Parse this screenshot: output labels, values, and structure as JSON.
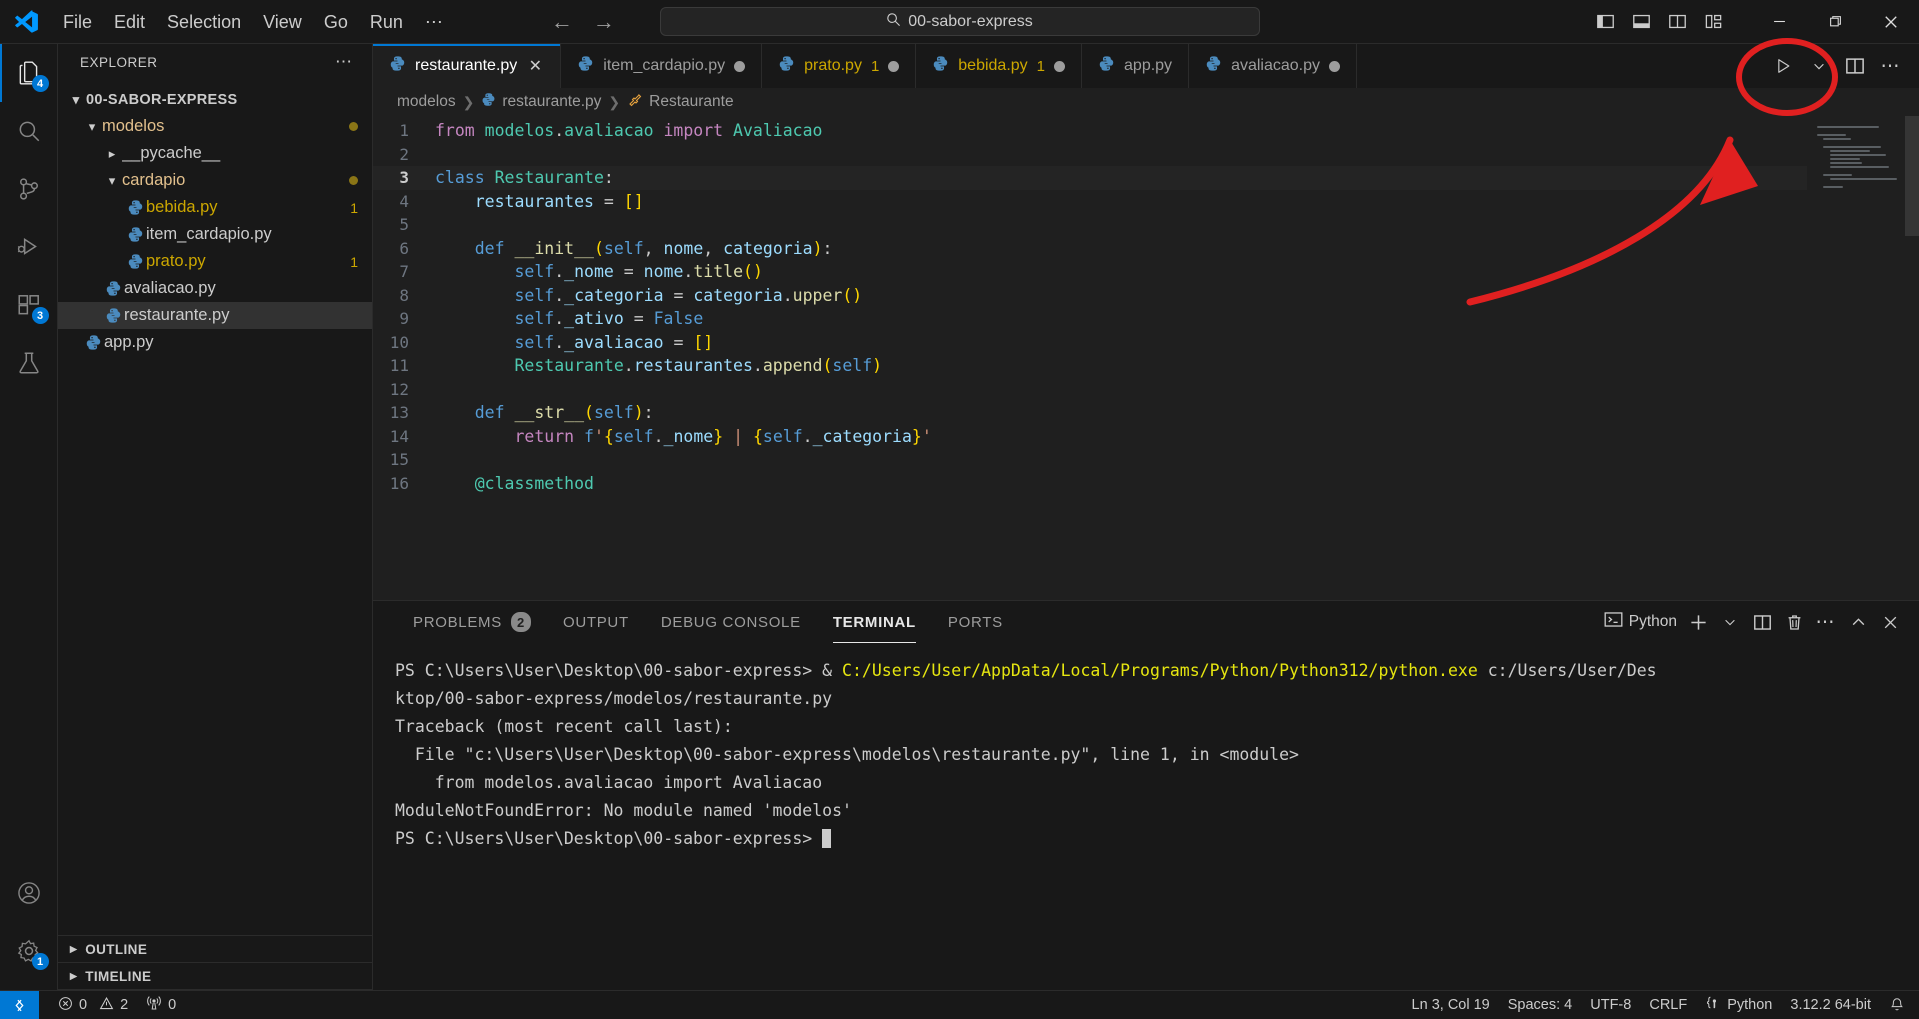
{
  "window": {
    "menus": [
      "File",
      "Edit",
      "Selection",
      "View",
      "Go",
      "Run",
      "⋯"
    ],
    "command_center_value": "00-sabor-express",
    "search_icon": "search-icon",
    "back_arrow": "←",
    "forward_arrow": "→",
    "minimize": "—",
    "maximize": "❐",
    "close": "✕"
  },
  "activity_bar": {
    "items": [
      {
        "name": "explorer",
        "icon": "files-icon",
        "badge": "4",
        "active": true
      },
      {
        "name": "search",
        "icon": "search-icon",
        "badge": "",
        "active": false
      },
      {
        "name": "source-control",
        "icon": "source-control-icon",
        "badge": "",
        "active": false
      },
      {
        "name": "run-and-debug",
        "icon": "run-debug-icon",
        "badge": "",
        "active": false
      },
      {
        "name": "extensions",
        "icon": "extensions-icon",
        "badge": "3",
        "active": false
      },
      {
        "name": "testing",
        "icon": "beaker-icon",
        "badge": "",
        "active": false
      }
    ],
    "bottom": [
      {
        "name": "accounts",
        "icon": "account-icon",
        "badge": ""
      },
      {
        "name": "manage",
        "icon": "gear-icon",
        "badge": "1"
      }
    ]
  },
  "sidebar": {
    "title": "EXPLORER",
    "more_actions": "⋯",
    "root": {
      "label": "00-SABOR-EXPRESS",
      "expanded": true
    },
    "tree": [
      {
        "label": "modelos",
        "type": "folder",
        "depth": 1,
        "expanded": true,
        "modified": true,
        "count": ""
      },
      {
        "label": "__pycache__",
        "type": "folder",
        "depth": 2,
        "expanded": false,
        "modified": false,
        "count": ""
      },
      {
        "label": "cardapio",
        "type": "folder",
        "depth": 2,
        "expanded": true,
        "modified": true,
        "count": ""
      },
      {
        "label": "bebida.py",
        "type": "python",
        "depth": 3,
        "expanded": null,
        "modified": false,
        "count": "1"
      },
      {
        "label": "item_cardapio.py",
        "type": "python",
        "depth": 3,
        "expanded": null,
        "modified": false,
        "count": ""
      },
      {
        "label": "prato.py",
        "type": "python",
        "depth": 3,
        "expanded": null,
        "modified": false,
        "count": "1"
      },
      {
        "label": "avaliacao.py",
        "type": "python",
        "depth": 2,
        "expanded": null,
        "modified": false,
        "count": ""
      },
      {
        "label": "restaurante.py",
        "type": "python",
        "depth": 2,
        "expanded": null,
        "modified": false,
        "count": "",
        "selected": true
      },
      {
        "label": "app.py",
        "type": "python",
        "depth": 1,
        "expanded": null,
        "modified": false,
        "count": ""
      }
    ],
    "sections": [
      {
        "label": "OUTLINE",
        "expanded": false
      },
      {
        "label": "TIMELINE",
        "expanded": false
      }
    ]
  },
  "tabs": [
    {
      "label": "restaurante.py",
      "active": true,
      "dirty": false,
      "count": "",
      "warn": false,
      "close": "✕"
    },
    {
      "label": "item_cardapio.py",
      "active": false,
      "dirty": true,
      "count": "",
      "warn": false
    },
    {
      "label": "prato.py",
      "active": false,
      "dirty": true,
      "count": "1",
      "warn": true
    },
    {
      "label": "bebida.py",
      "active": false,
      "dirty": true,
      "count": "1",
      "warn": true
    },
    {
      "label": "app.py",
      "active": false,
      "dirty": false,
      "count": "",
      "warn": false
    },
    {
      "label": "avaliacao.py",
      "active": false,
      "dirty": true,
      "count": "",
      "warn": false
    }
  ],
  "editor_actions": [
    {
      "name": "run-python-file",
      "icon": "play-icon"
    },
    {
      "name": "run-options-dropdown",
      "icon": "chevron-down-icon"
    },
    {
      "name": "split-editor-right",
      "icon": "split-editor-icon"
    },
    {
      "name": "more-editor-actions",
      "icon": "ellipsis-icon"
    }
  ],
  "breadcrumb": [
    {
      "label": "modelos",
      "icon": ""
    },
    {
      "label": "restaurante.py",
      "icon": "python-icon"
    },
    {
      "label": "Restaurante",
      "icon": "class-icon"
    }
  ],
  "code": {
    "language": "Python",
    "current_line": 3,
    "lines": [
      {
        "n": 1,
        "segments": [
          {
            "t": "from ",
            "c": "k"
          },
          {
            "t": "modelos",
            "c": "t"
          },
          {
            "t": ".",
            "c": "d"
          },
          {
            "t": "avaliacao ",
            "c": "t"
          },
          {
            "t": "import ",
            "c": "k"
          },
          {
            "t": "Avaliacao",
            "c": "t"
          }
        ]
      },
      {
        "n": 2,
        "segments": []
      },
      {
        "n": 3,
        "segments": [
          {
            "t": "class ",
            "c": "kb"
          },
          {
            "t": "Restaurante",
            "c": "t"
          },
          {
            "t": ":",
            "c": "d"
          }
        ]
      },
      {
        "n": 4,
        "segments": [
          {
            "t": "    ",
            "c": "d"
          },
          {
            "t": "restaurantes",
            "c": "v"
          },
          {
            "t": " = ",
            "c": "d"
          },
          {
            "t": "[]",
            "c": "p"
          }
        ]
      },
      {
        "n": 5,
        "segments": []
      },
      {
        "n": 6,
        "segments": [
          {
            "t": "    ",
            "c": "d"
          },
          {
            "t": "def ",
            "c": "kb"
          },
          {
            "t": "__init__",
            "c": "f"
          },
          {
            "t": "(",
            "c": "p"
          },
          {
            "t": "self",
            "c": "kb"
          },
          {
            "t": ", ",
            "c": "d"
          },
          {
            "t": "nome",
            "c": "v"
          },
          {
            "t": ", ",
            "c": "d"
          },
          {
            "t": "categoria",
            "c": "v"
          },
          {
            "t": ")",
            "c": "p"
          },
          {
            "t": ":",
            "c": "d"
          }
        ]
      },
      {
        "n": 7,
        "segments": [
          {
            "t": "        ",
            "c": "d"
          },
          {
            "t": "self",
            "c": "kb"
          },
          {
            "t": ".",
            "c": "d"
          },
          {
            "t": "_nome",
            "c": "v"
          },
          {
            "t": " = ",
            "c": "d"
          },
          {
            "t": "nome",
            "c": "v"
          },
          {
            "t": ".",
            "c": "d"
          },
          {
            "t": "title",
            "c": "f"
          },
          {
            "t": "()",
            "c": "p"
          }
        ]
      },
      {
        "n": 8,
        "segments": [
          {
            "t": "        ",
            "c": "d"
          },
          {
            "t": "self",
            "c": "kb"
          },
          {
            "t": ".",
            "c": "d"
          },
          {
            "t": "_categoria",
            "c": "v"
          },
          {
            "t": " = ",
            "c": "d"
          },
          {
            "t": "categoria",
            "c": "v"
          },
          {
            "t": ".",
            "c": "d"
          },
          {
            "t": "upper",
            "c": "f"
          },
          {
            "t": "()",
            "c": "p"
          }
        ]
      },
      {
        "n": 9,
        "segments": [
          {
            "t": "        ",
            "c": "d"
          },
          {
            "t": "self",
            "c": "kb"
          },
          {
            "t": ".",
            "c": "d"
          },
          {
            "t": "_ativo",
            "c": "v"
          },
          {
            "t": " = ",
            "c": "d"
          },
          {
            "t": "False",
            "c": "kb"
          }
        ]
      },
      {
        "n": 10,
        "segments": [
          {
            "t": "        ",
            "c": "d"
          },
          {
            "t": "self",
            "c": "kb"
          },
          {
            "t": ".",
            "c": "d"
          },
          {
            "t": "_avaliacao",
            "c": "v"
          },
          {
            "t": " = ",
            "c": "d"
          },
          {
            "t": "[]",
            "c": "p"
          }
        ]
      },
      {
        "n": 11,
        "segments": [
          {
            "t": "        ",
            "c": "d"
          },
          {
            "t": "Restaurante",
            "c": "t"
          },
          {
            "t": ".",
            "c": "d"
          },
          {
            "t": "restaurantes",
            "c": "v"
          },
          {
            "t": ".",
            "c": "d"
          },
          {
            "t": "append",
            "c": "f"
          },
          {
            "t": "(",
            "c": "p"
          },
          {
            "t": "self",
            "c": "kb"
          },
          {
            "t": ")",
            "c": "p"
          }
        ]
      },
      {
        "n": 12,
        "segments": []
      },
      {
        "n": 13,
        "segments": [
          {
            "t": "    ",
            "c": "d"
          },
          {
            "t": "def ",
            "c": "kb"
          },
          {
            "t": "__str__",
            "c": "f"
          },
          {
            "t": "(",
            "c": "p"
          },
          {
            "t": "self",
            "c": "kb"
          },
          {
            "t": ")",
            "c": "p"
          },
          {
            "t": ":",
            "c": "d"
          }
        ]
      },
      {
        "n": 14,
        "segments": [
          {
            "t": "        ",
            "c": "d"
          },
          {
            "t": "return ",
            "c": "k"
          },
          {
            "t": "f",
            "c": "kb"
          },
          {
            "t": "'",
            "c": "s"
          },
          {
            "t": "{",
            "c": "p"
          },
          {
            "t": "self",
            "c": "kb"
          },
          {
            "t": ".",
            "c": "d"
          },
          {
            "t": "_nome",
            "c": "v"
          },
          {
            "t": "}",
            "c": "p"
          },
          {
            "t": " ",
            "c": "s"
          },
          {
            "t": "|",
            "c": "s"
          },
          {
            "t": " ",
            "c": "s"
          },
          {
            "t": "{",
            "c": "p"
          },
          {
            "t": "self",
            "c": "kb"
          },
          {
            "t": ".",
            "c": "d"
          },
          {
            "t": "_categoria",
            "c": "v"
          },
          {
            "t": "}",
            "c": "p"
          },
          {
            "t": "'",
            "c": "s"
          }
        ]
      },
      {
        "n": 15,
        "segments": []
      },
      {
        "n": 16,
        "segments": [
          {
            "t": "    ",
            "c": "d"
          },
          {
            "t": "@classmethod",
            "c": "t"
          }
        ]
      }
    ]
  },
  "panel": {
    "tabs": [
      {
        "label": "PROBLEMS",
        "badge": "2",
        "active": false
      },
      {
        "label": "OUTPUT",
        "badge": "",
        "active": false
      },
      {
        "label": "DEBUG CONSOLE",
        "badge": "",
        "active": false
      },
      {
        "label": "TERMINAL",
        "badge": "",
        "active": true
      },
      {
        "label": "PORTS",
        "badge": "",
        "active": false
      }
    ],
    "shell_label": "Python",
    "actions": [
      {
        "name": "new-terminal",
        "icon": "plus-icon"
      },
      {
        "name": "terminal-profile-dropdown",
        "icon": "chevron-down-icon"
      },
      {
        "name": "split-terminal",
        "icon": "split-icon"
      },
      {
        "name": "kill-terminal",
        "icon": "trash-icon"
      },
      {
        "name": "terminal-more-actions",
        "icon": "ellipsis-icon"
      },
      {
        "name": "maximize-panel",
        "icon": "chevron-up-icon"
      },
      {
        "name": "close-panel",
        "icon": "close-icon"
      }
    ],
    "terminal_lines": [
      [
        {
          "t": "PS C:\\Users\\User\\Desktop\\00-sabor-express> & ",
          "c": "d"
        },
        {
          "t": "C:/Users/User/AppData/Local/Programs/Python/Python312/python.exe",
          "c": "y"
        },
        {
          "t": " c:/Users/User/Des",
          "c": "d"
        }
      ],
      [
        {
          "t": "ktop/00-sabor-express/modelos/restaurante.py",
          "c": "d"
        }
      ],
      [
        {
          "t": "Traceback (most recent call last):",
          "c": "d"
        }
      ],
      [
        {
          "t": "  File \"c:\\Users\\User\\Desktop\\00-sabor-express\\modelos\\restaurante.py\", line 1, in <module>",
          "c": "d"
        }
      ],
      [
        {
          "t": "    from modelos.avaliacao import Avaliacao",
          "c": "d"
        }
      ],
      [
        {
          "t": "ModuleNotFoundError: No module named 'modelos'",
          "c": "d"
        }
      ],
      [
        {
          "t": "PS C:\\Users\\User\\Desktop\\00-sabor-express> ",
          "c": "d"
        },
        {
          "t": "█",
          "c": "cur"
        }
      ]
    ]
  },
  "statusbar": {
    "remote_icon": "remote-window-icon",
    "errors": "0",
    "warnings": "2",
    "ports": "0",
    "right": [
      {
        "name": "editor-position",
        "label": "Ln 3, Col 19"
      },
      {
        "name": "indentation",
        "label": "Spaces: 4"
      },
      {
        "name": "encoding",
        "label": "UTF-8"
      },
      {
        "name": "eol",
        "label": "CRLF"
      },
      {
        "name": "language-mode",
        "label": "Python"
      },
      {
        "name": "python-interpreter",
        "label": "3.12.2 64-bit"
      }
    ],
    "bell_icon": "bell-icon"
  },
  "annotation": {
    "color": "#e02020",
    "shapes": "circle-around-run-button-and-arrow"
  }
}
